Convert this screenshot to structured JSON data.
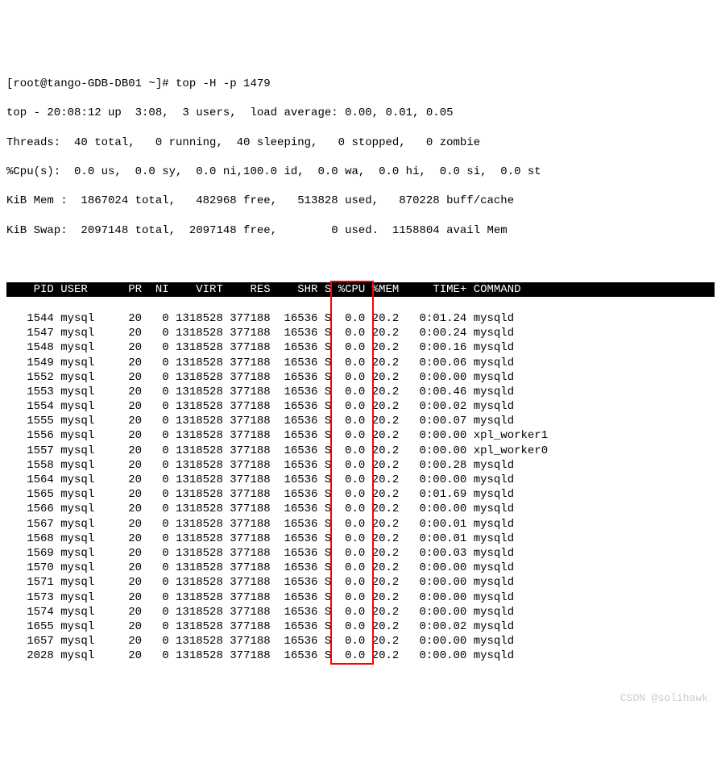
{
  "prompt": "[root@tango-GDB-DB01 ~]# top -H -p 1479",
  "summary": {
    "line1": "top - 20:08:12 up  3:08,  3 users,  load average: 0.00, 0.01, 0.05",
    "line2": "Threads:  40 total,   0 running,  40 sleeping,   0 stopped,   0 zombie",
    "line3": "%Cpu(s):  0.0 us,  0.0 sy,  0.0 ni,100.0 id,  0.0 wa,  0.0 hi,  0.0 si,  0.0 st",
    "line4": "KiB Mem :  1867024 total,   482968 free,   513828 used,   870228 buff/cache",
    "line5": "KiB Swap:  2097148 total,  2097148 free,        0 used.  1158804 avail Mem"
  },
  "columns": "    PID USER      PR  NI    VIRT    RES    SHR S %CPU %MEM     TIME+ COMMAND         ",
  "rows": [
    {
      "pid": "1544",
      "user": "mysql",
      "pr": "20",
      "ni": "0",
      "virt": "1318528",
      "res": "377188",
      "shr": "16536",
      "s": "S",
      "cpu": "0.0",
      "mem": "20.2",
      "time": "0:01.24",
      "cmd": "mysqld"
    },
    {
      "pid": "1547",
      "user": "mysql",
      "pr": "20",
      "ni": "0",
      "virt": "1318528",
      "res": "377188",
      "shr": "16536",
      "s": "S",
      "cpu": "0.0",
      "mem": "20.2",
      "time": "0:00.24",
      "cmd": "mysqld"
    },
    {
      "pid": "1548",
      "user": "mysql",
      "pr": "20",
      "ni": "0",
      "virt": "1318528",
      "res": "377188",
      "shr": "16536",
      "s": "S",
      "cpu": "0.0",
      "mem": "20.2",
      "time": "0:00.16",
      "cmd": "mysqld"
    },
    {
      "pid": "1549",
      "user": "mysql",
      "pr": "20",
      "ni": "0",
      "virt": "1318528",
      "res": "377188",
      "shr": "16536",
      "s": "S",
      "cpu": "0.0",
      "mem": "20.2",
      "time": "0:00.06",
      "cmd": "mysqld"
    },
    {
      "pid": "1552",
      "user": "mysql",
      "pr": "20",
      "ni": "0",
      "virt": "1318528",
      "res": "377188",
      "shr": "16536",
      "s": "S",
      "cpu": "0.0",
      "mem": "20.2",
      "time": "0:00.00",
      "cmd": "mysqld"
    },
    {
      "pid": "1553",
      "user": "mysql",
      "pr": "20",
      "ni": "0",
      "virt": "1318528",
      "res": "377188",
      "shr": "16536",
      "s": "S",
      "cpu": "0.0",
      "mem": "20.2",
      "time": "0:00.46",
      "cmd": "mysqld"
    },
    {
      "pid": "1554",
      "user": "mysql",
      "pr": "20",
      "ni": "0",
      "virt": "1318528",
      "res": "377188",
      "shr": "16536",
      "s": "S",
      "cpu": "0.0",
      "mem": "20.2",
      "time": "0:00.02",
      "cmd": "mysqld"
    },
    {
      "pid": "1555",
      "user": "mysql",
      "pr": "20",
      "ni": "0",
      "virt": "1318528",
      "res": "377188",
      "shr": "16536",
      "s": "S",
      "cpu": "0.0",
      "mem": "20.2",
      "time": "0:00.07",
      "cmd": "mysqld"
    },
    {
      "pid": "1556",
      "user": "mysql",
      "pr": "20",
      "ni": "0",
      "virt": "1318528",
      "res": "377188",
      "shr": "16536",
      "s": "S",
      "cpu": "0.0",
      "mem": "20.2",
      "time": "0:00.00",
      "cmd": "xpl_worker1"
    },
    {
      "pid": "1557",
      "user": "mysql",
      "pr": "20",
      "ni": "0",
      "virt": "1318528",
      "res": "377188",
      "shr": "16536",
      "s": "S",
      "cpu": "0.0",
      "mem": "20.2",
      "time": "0:00.00",
      "cmd": "xpl_worker0"
    },
    {
      "pid": "1558",
      "user": "mysql",
      "pr": "20",
      "ni": "0",
      "virt": "1318528",
      "res": "377188",
      "shr": "16536",
      "s": "S",
      "cpu": "0.0",
      "mem": "20.2",
      "time": "0:00.28",
      "cmd": "mysqld"
    },
    {
      "pid": "1564",
      "user": "mysql",
      "pr": "20",
      "ni": "0",
      "virt": "1318528",
      "res": "377188",
      "shr": "16536",
      "s": "S",
      "cpu": "0.0",
      "mem": "20.2",
      "time": "0:00.00",
      "cmd": "mysqld"
    },
    {
      "pid": "1565",
      "user": "mysql",
      "pr": "20",
      "ni": "0",
      "virt": "1318528",
      "res": "377188",
      "shr": "16536",
      "s": "S",
      "cpu": "0.0",
      "mem": "20.2",
      "time": "0:01.69",
      "cmd": "mysqld"
    },
    {
      "pid": "1566",
      "user": "mysql",
      "pr": "20",
      "ni": "0",
      "virt": "1318528",
      "res": "377188",
      "shr": "16536",
      "s": "S",
      "cpu": "0.0",
      "mem": "20.2",
      "time": "0:00.00",
      "cmd": "mysqld"
    },
    {
      "pid": "1567",
      "user": "mysql",
      "pr": "20",
      "ni": "0",
      "virt": "1318528",
      "res": "377188",
      "shr": "16536",
      "s": "S",
      "cpu": "0.0",
      "mem": "20.2",
      "time": "0:00.01",
      "cmd": "mysqld"
    },
    {
      "pid": "1568",
      "user": "mysql",
      "pr": "20",
      "ni": "0",
      "virt": "1318528",
      "res": "377188",
      "shr": "16536",
      "s": "S",
      "cpu": "0.0",
      "mem": "20.2",
      "time": "0:00.01",
      "cmd": "mysqld"
    },
    {
      "pid": "1569",
      "user": "mysql",
      "pr": "20",
      "ni": "0",
      "virt": "1318528",
      "res": "377188",
      "shr": "16536",
      "s": "S",
      "cpu": "0.0",
      "mem": "20.2",
      "time": "0:00.03",
      "cmd": "mysqld"
    },
    {
      "pid": "1570",
      "user": "mysql",
      "pr": "20",
      "ni": "0",
      "virt": "1318528",
      "res": "377188",
      "shr": "16536",
      "s": "S",
      "cpu": "0.0",
      "mem": "20.2",
      "time": "0:00.00",
      "cmd": "mysqld"
    },
    {
      "pid": "1571",
      "user": "mysql",
      "pr": "20",
      "ni": "0",
      "virt": "1318528",
      "res": "377188",
      "shr": "16536",
      "s": "S",
      "cpu": "0.0",
      "mem": "20.2",
      "time": "0:00.00",
      "cmd": "mysqld"
    },
    {
      "pid": "1573",
      "user": "mysql",
      "pr": "20",
      "ni": "0",
      "virt": "1318528",
      "res": "377188",
      "shr": "16536",
      "s": "S",
      "cpu": "0.0",
      "mem": "20.2",
      "time": "0:00.00",
      "cmd": "mysqld"
    },
    {
      "pid": "1574",
      "user": "mysql",
      "pr": "20",
      "ni": "0",
      "virt": "1318528",
      "res": "377188",
      "shr": "16536",
      "s": "S",
      "cpu": "0.0",
      "mem": "20.2",
      "time": "0:00.00",
      "cmd": "mysqld"
    },
    {
      "pid": "1655",
      "user": "mysql",
      "pr": "20",
      "ni": "0",
      "virt": "1318528",
      "res": "377188",
      "shr": "16536",
      "s": "S",
      "cpu": "0.0",
      "mem": "20.2",
      "time": "0:00.02",
      "cmd": "mysqld"
    },
    {
      "pid": "1657",
      "user": "mysql",
      "pr": "20",
      "ni": "0",
      "virt": "1318528",
      "res": "377188",
      "shr": "16536",
      "s": "S",
      "cpu": "0.0",
      "mem": "20.2",
      "time": "0:00.00",
      "cmd": "mysqld"
    },
    {
      "pid": "2028",
      "user": "mysql",
      "pr": "20",
      "ni": "0",
      "virt": "1318528",
      "res": "377188",
      "shr": "16536",
      "s": "S",
      "cpu": "0.0",
      "mem": "20.2",
      "time": "0:00.00",
      "cmd": "mysqld"
    }
  ],
  "watermark": "CSDN @solihawk",
  "highlight": {
    "column": "%CPU"
  }
}
